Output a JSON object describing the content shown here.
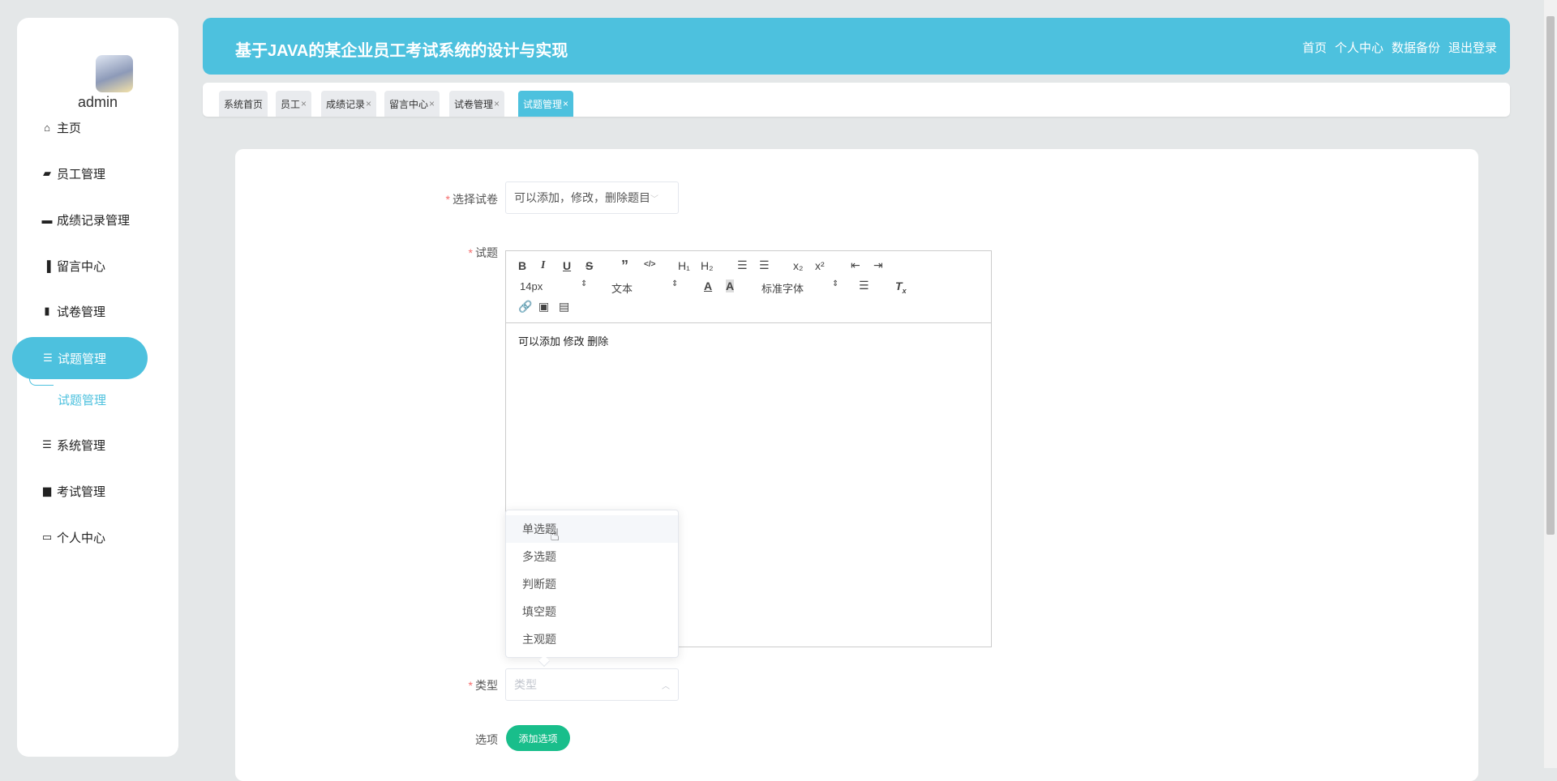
{
  "sidebar": {
    "username": "admin",
    "items": [
      {
        "label": "主页",
        "icon": "home-icon"
      },
      {
        "label": "员工管理",
        "icon": "wallet-icon"
      },
      {
        "label": "成绩记录管理",
        "icon": "monitor-icon"
      },
      {
        "label": "留言中心",
        "icon": "bar-chart-icon"
      },
      {
        "label": "试卷管理",
        "icon": "books-icon"
      },
      {
        "label": "试题管理",
        "icon": "list-icon"
      },
      {
        "label": "系统管理",
        "icon": "menu-icon"
      },
      {
        "label": "考试管理",
        "icon": "briefcase-icon"
      },
      {
        "label": "个人中心",
        "icon": "card-icon"
      }
    ],
    "submenu": "试题管理"
  },
  "header": {
    "title": "基于JAVA的某企业员工考试系统的设计与实现",
    "nav": [
      "首页",
      "个人中心",
      "数据备份",
      "退出登录"
    ]
  },
  "tabs": [
    {
      "label": "系统首页",
      "closable": false
    },
    {
      "label": "员工",
      "closable": true
    },
    {
      "label": "成绩记录",
      "closable": true
    },
    {
      "label": "留言中心",
      "closable": true
    },
    {
      "label": "试卷管理",
      "closable": true
    },
    {
      "label": "试题管理",
      "closable": true,
      "active": true
    }
  ],
  "form": {
    "paper_label": "选择试卷",
    "paper_value": "可以添加，修改，删除题目",
    "question_label": "试题",
    "editor": {
      "font_size": "14px",
      "header": "文本",
      "font": "标准字体",
      "content": "可以添加 修改 删除"
    },
    "type_label": "类型",
    "type_placeholder": "类型",
    "type_options": [
      "单选题",
      "多选题",
      "判断题",
      "填空题",
      "主观题"
    ],
    "options_label": "选项",
    "add_option": "添加选项"
  },
  "colors": {
    "accent": "#4dc1de",
    "success": "#19be8b"
  }
}
